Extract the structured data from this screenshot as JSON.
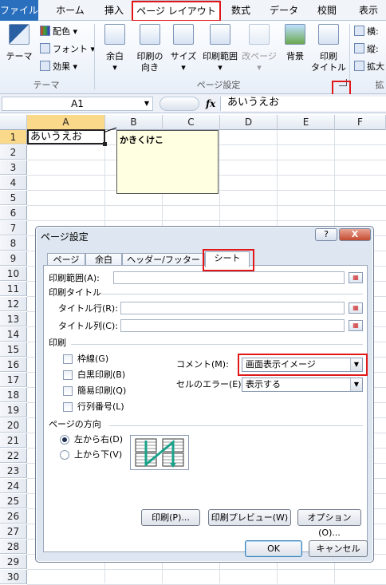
{
  "ribbon_tabs": [
    "ファイル",
    "ホーム",
    "挿入",
    "ページ レイアウト",
    "数式",
    "データ",
    "校閲",
    "表示"
  ],
  "ribbon": {
    "theme_btn": "テーマ",
    "colors": "配色",
    "fonts": "フォント",
    "effects": "効果",
    "theme_group": "テーマ",
    "margins": "余白",
    "orientation": "印刷の\n向き",
    "size": "サイズ",
    "print_area": "印刷範囲",
    "breaks": "改ページ",
    "background": "背景",
    "print_titles": "印刷\nタイトル",
    "page_setup_group": "ページ設定",
    "width": "横:",
    "height": "縦:",
    "scale": "拡大",
    "scale_group": "拡"
  },
  "formula_bar": {
    "name_box": "A1",
    "fx": "fx",
    "content": "あいうえお"
  },
  "sheet": {
    "columns": [
      "A",
      "B",
      "C",
      "D",
      "E",
      "F"
    ],
    "rows": [
      "1",
      "2",
      "3",
      "4",
      "5",
      "6",
      "7",
      "8",
      "9",
      "10",
      "11",
      "12",
      "13",
      "14",
      "15",
      "16",
      "17",
      "18",
      "19",
      "20",
      "21",
      "22",
      "23",
      "24",
      "25",
      "26",
      "27",
      "28",
      "29",
      "30"
    ],
    "a1": "あいうえお",
    "comment": "かきくけこ"
  },
  "dialog": {
    "title": "ページ設定",
    "help": "?",
    "close": "X",
    "tabs": [
      "ページ",
      "余白",
      "ヘッダー/フッター",
      "シート"
    ],
    "print_area_label": "印刷範囲(A):",
    "print_titles_label": "印刷タイトル",
    "title_rows_label": "タイトル行(R):",
    "title_cols_label": "タイトル列(C):",
    "print_label": "印刷",
    "gridlines": "枠線(G)",
    "bw": "白黒印刷(B)",
    "draft": "簡易印刷(Q)",
    "headings": "行列番号(L)",
    "comments_label": "コメント(M):",
    "comments_value": "画面表示イメージ",
    "errors_label": "セルのエラー(E):",
    "errors_value": "表示する",
    "page_order_label": "ページの方向",
    "down_then_over": "左から右(D)",
    "over_then_down": "上から下(V)",
    "print_btn": "印刷(P)...",
    "preview_btn": "印刷プレビュー(W)",
    "options_btn": "オプション(O)...",
    "ok": "OK",
    "cancel": "キャンセル"
  },
  "colors": {
    "file_tab": "#2a6fbd",
    "highlight": "#e01818",
    "comment_bg": "#ffffe1"
  }
}
